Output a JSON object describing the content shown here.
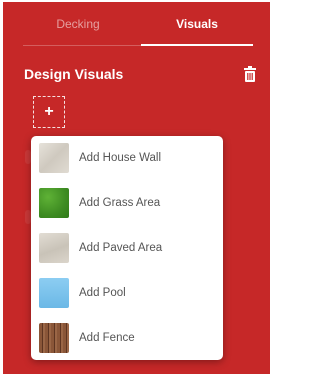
{
  "tabs": [
    {
      "label": "Decking",
      "active": false
    },
    {
      "label": "Visuals",
      "active": true
    }
  ],
  "section": {
    "title": "Design Visuals"
  },
  "add_button": {
    "symbol": "+"
  },
  "icons": {
    "delete": "trash-icon",
    "add": "plus-icon"
  },
  "colors": {
    "panel": "#c62828",
    "menu_bg": "#ffffff",
    "menu_text": "#555555"
  },
  "menu": {
    "items": [
      {
        "label": "Add House Wall",
        "swatch": "house-wall-texture",
        "color": "#d9d4cc"
      },
      {
        "label": "Add Grass Area",
        "swatch": "grass-texture",
        "color": "#4a9a2a"
      },
      {
        "label": "Add Paved Area",
        "swatch": "paving-texture",
        "color": "#d3cdc3"
      },
      {
        "label": "Add Pool",
        "swatch": "pool-water",
        "color": "#7fc4ec"
      },
      {
        "label": "Add Fence",
        "swatch": "fence-wood",
        "color": "#7a4a30"
      }
    ]
  }
}
